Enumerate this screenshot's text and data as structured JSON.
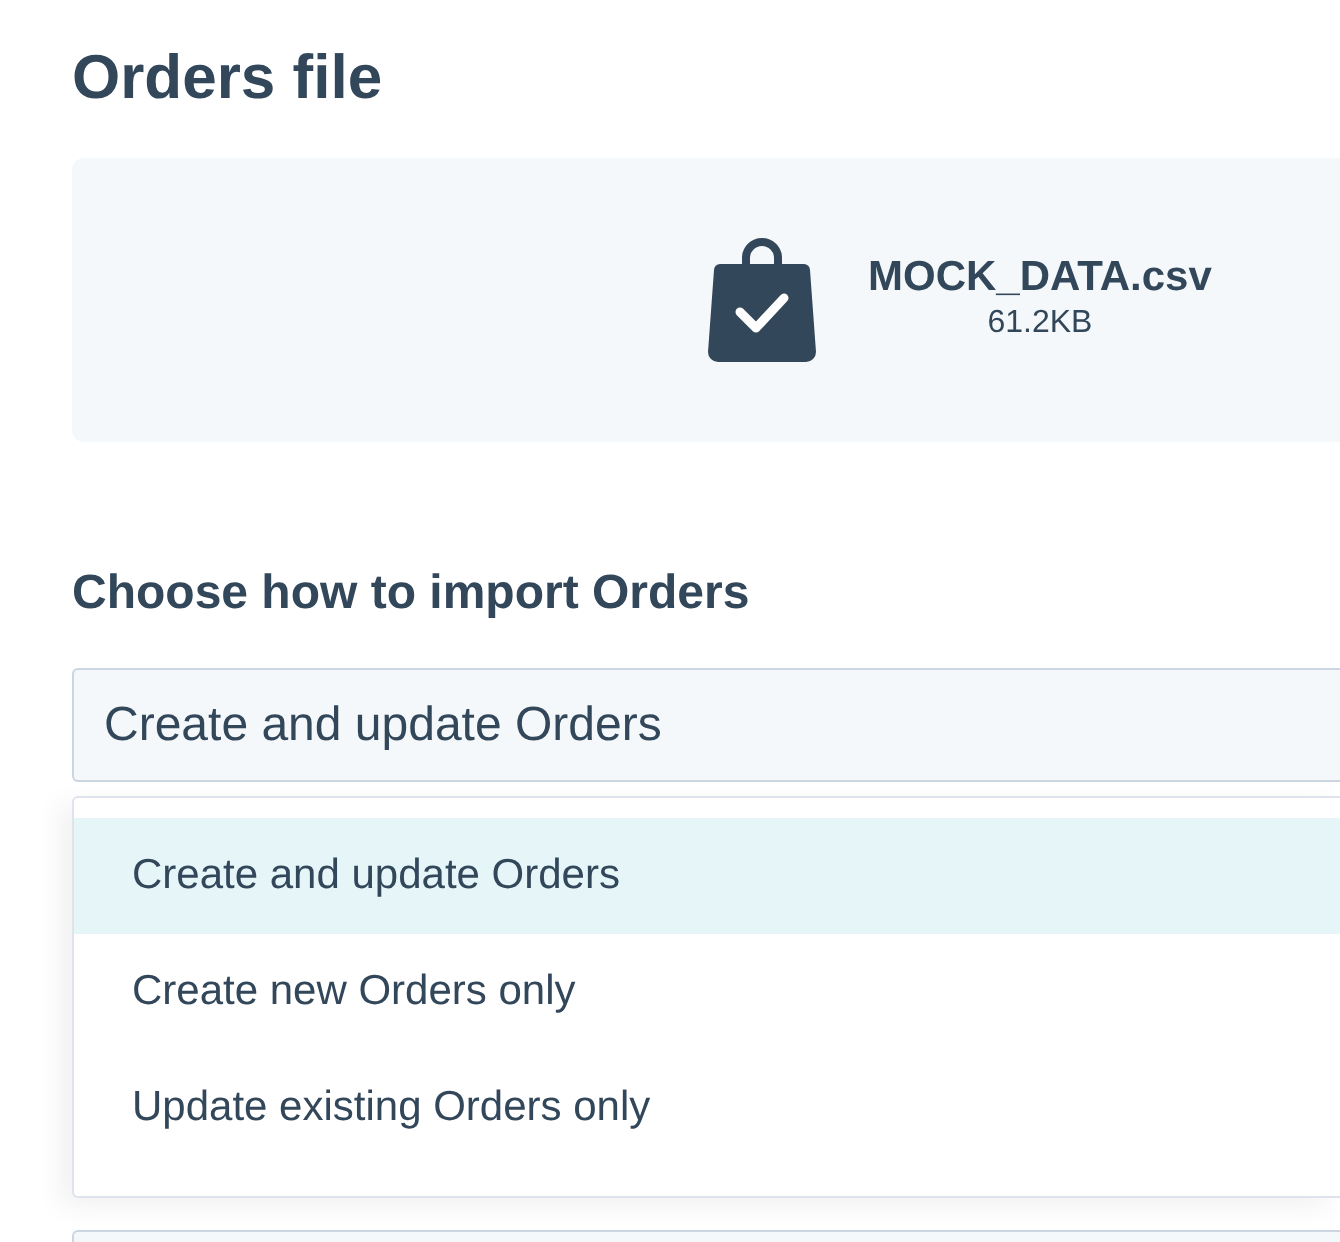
{
  "title": "Orders file",
  "file": {
    "name": "MOCK_DATA.csv",
    "size": "61.2KB"
  },
  "import": {
    "label": "Choose how to import Orders",
    "select": {
      "value": "Create and update Orders",
      "expanded": true
    },
    "options": [
      {
        "label": "Create and update Orders",
        "selected": true
      },
      {
        "label": "Create new Orders only",
        "selected": false
      },
      {
        "label": "Update existing Orders only",
        "selected": false
      }
    ]
  }
}
